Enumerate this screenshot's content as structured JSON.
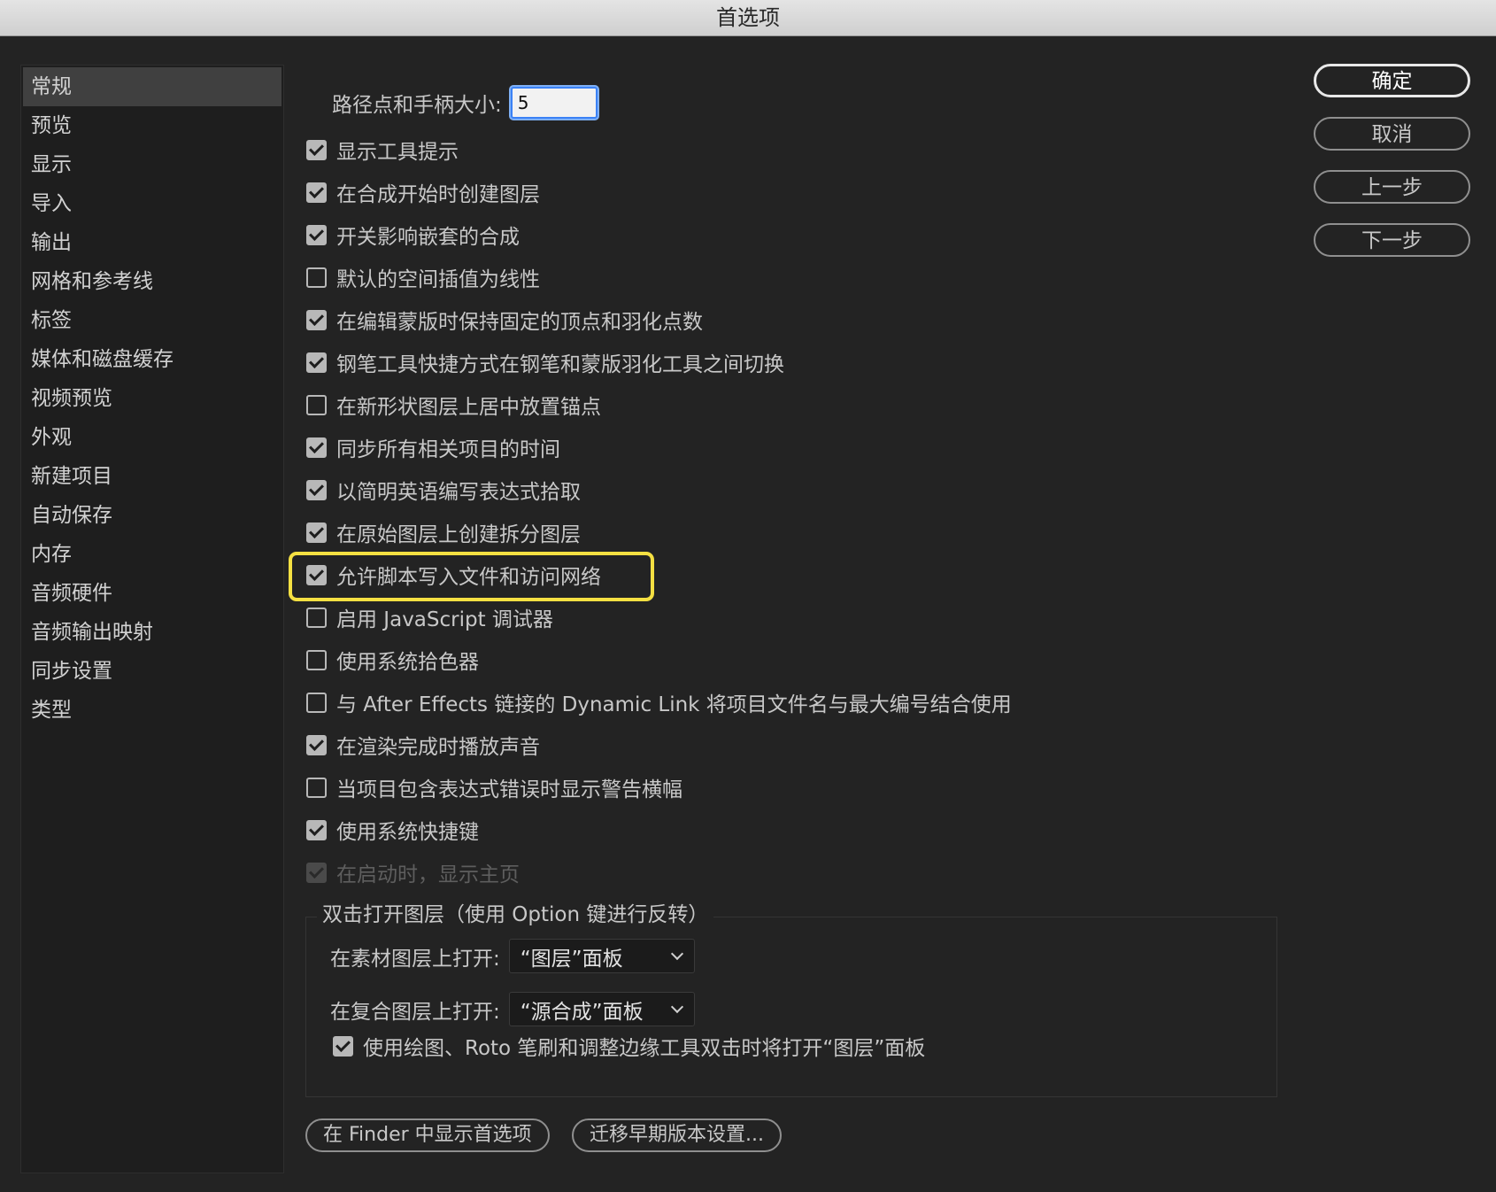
{
  "window": {
    "title": "首选项"
  },
  "sidebar": {
    "items": [
      {
        "label": "常规",
        "selected": true
      },
      {
        "label": "预览"
      },
      {
        "label": "显示"
      },
      {
        "label": "导入"
      },
      {
        "label": "输出"
      },
      {
        "label": "网格和参考线"
      },
      {
        "label": "标签"
      },
      {
        "label": "媒体和磁盘缓存"
      },
      {
        "label": "视频预览"
      },
      {
        "label": "外观"
      },
      {
        "label": "新建项目"
      },
      {
        "label": "自动保存"
      },
      {
        "label": "内存"
      },
      {
        "label": "音频硬件"
      },
      {
        "label": "音频输出映射"
      },
      {
        "label": "同步设置"
      },
      {
        "label": "类型"
      }
    ]
  },
  "main": {
    "path_label": "路径点和手柄大小:",
    "path_value": "5",
    "checkboxes": [
      {
        "label": "显示工具提示",
        "checked": true
      },
      {
        "label": "在合成开始时创建图层",
        "checked": true
      },
      {
        "label": "开关影响嵌套的合成",
        "checked": true
      },
      {
        "label": "默认的空间插值为线性",
        "checked": false
      },
      {
        "label": "在编辑蒙版时保持固定的顶点和羽化点数",
        "checked": true
      },
      {
        "label": "钢笔工具快捷方式在钢笔和蒙版羽化工具之间切换",
        "checked": true
      },
      {
        "label": "在新形状图层上居中放置锚点",
        "checked": false
      },
      {
        "label": "同步所有相关项目的时间",
        "checked": true
      },
      {
        "label": "以简明英语编写表达式拾取",
        "checked": true
      },
      {
        "label": "在原始图层上创建拆分图层",
        "checked": true
      },
      {
        "label": "允许脚本写入文件和访问网络",
        "checked": true,
        "highlighted": true
      },
      {
        "label": "启用 JavaScript 调试器",
        "checked": false
      },
      {
        "label": "使用系统拾色器",
        "checked": false
      },
      {
        "label": "与 After Effects 链接的 Dynamic Link 将项目文件名与最大编号结合使用",
        "checked": false
      },
      {
        "label": "在渲染完成时播放声音",
        "checked": true
      },
      {
        "label": "当项目包含表达式错误时显示警告横幅",
        "checked": false
      },
      {
        "label": "使用系统快捷键",
        "checked": true
      },
      {
        "label": "在启动时，显示主页",
        "checked": true,
        "disabled": true
      }
    ],
    "group": {
      "title": "双击打开图层（使用 Option 键进行反转）",
      "footage_label": "在素材图层上打开:",
      "footage_value": "“图层”面板",
      "comp_label": "在复合图层上打开:",
      "comp_value": "“源合成”面板",
      "roto_label": "使用绘图、Roto 笔刷和调整边缘工具双击时将打开“图层”面板",
      "roto_checked": true
    },
    "reveal_button": "在 Finder 中显示首选项",
    "migrate_button": "迁移早期版本设置..."
  },
  "buttons": {
    "ok": "确定",
    "cancel": "取消",
    "prev": "上一步",
    "next": "下一步"
  },
  "colors": {
    "background": "#232323",
    "highlight": "#f5e042",
    "focus": "#3b82f6"
  }
}
